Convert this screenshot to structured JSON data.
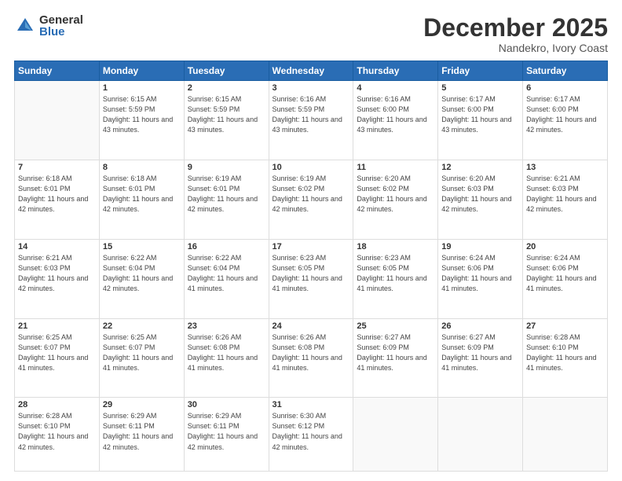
{
  "logo": {
    "general": "General",
    "blue": "Blue"
  },
  "title": "December 2025",
  "subtitle": "Nandekro, Ivory Coast",
  "days_header": [
    "Sunday",
    "Monday",
    "Tuesday",
    "Wednesday",
    "Thursday",
    "Friday",
    "Saturday"
  ],
  "weeks": [
    [
      {
        "num": "",
        "empty": true
      },
      {
        "num": "1",
        "sunrise": "Sunrise: 6:15 AM",
        "sunset": "Sunset: 5:59 PM",
        "daylight": "Daylight: 11 hours and 43 minutes."
      },
      {
        "num": "2",
        "sunrise": "Sunrise: 6:15 AM",
        "sunset": "Sunset: 5:59 PM",
        "daylight": "Daylight: 11 hours and 43 minutes."
      },
      {
        "num": "3",
        "sunrise": "Sunrise: 6:16 AM",
        "sunset": "Sunset: 5:59 PM",
        "daylight": "Daylight: 11 hours and 43 minutes."
      },
      {
        "num": "4",
        "sunrise": "Sunrise: 6:16 AM",
        "sunset": "Sunset: 6:00 PM",
        "daylight": "Daylight: 11 hours and 43 minutes."
      },
      {
        "num": "5",
        "sunrise": "Sunrise: 6:17 AM",
        "sunset": "Sunset: 6:00 PM",
        "daylight": "Daylight: 11 hours and 43 minutes."
      },
      {
        "num": "6",
        "sunrise": "Sunrise: 6:17 AM",
        "sunset": "Sunset: 6:00 PM",
        "daylight": "Daylight: 11 hours and 42 minutes."
      }
    ],
    [
      {
        "num": "7",
        "sunrise": "Sunrise: 6:18 AM",
        "sunset": "Sunset: 6:01 PM",
        "daylight": "Daylight: 11 hours and 42 minutes."
      },
      {
        "num": "8",
        "sunrise": "Sunrise: 6:18 AM",
        "sunset": "Sunset: 6:01 PM",
        "daylight": "Daylight: 11 hours and 42 minutes."
      },
      {
        "num": "9",
        "sunrise": "Sunrise: 6:19 AM",
        "sunset": "Sunset: 6:01 PM",
        "daylight": "Daylight: 11 hours and 42 minutes."
      },
      {
        "num": "10",
        "sunrise": "Sunrise: 6:19 AM",
        "sunset": "Sunset: 6:02 PM",
        "daylight": "Daylight: 11 hours and 42 minutes."
      },
      {
        "num": "11",
        "sunrise": "Sunrise: 6:20 AM",
        "sunset": "Sunset: 6:02 PM",
        "daylight": "Daylight: 11 hours and 42 minutes."
      },
      {
        "num": "12",
        "sunrise": "Sunrise: 6:20 AM",
        "sunset": "Sunset: 6:03 PM",
        "daylight": "Daylight: 11 hours and 42 minutes."
      },
      {
        "num": "13",
        "sunrise": "Sunrise: 6:21 AM",
        "sunset": "Sunset: 6:03 PM",
        "daylight": "Daylight: 11 hours and 42 minutes."
      }
    ],
    [
      {
        "num": "14",
        "sunrise": "Sunrise: 6:21 AM",
        "sunset": "Sunset: 6:03 PM",
        "daylight": "Daylight: 11 hours and 42 minutes."
      },
      {
        "num": "15",
        "sunrise": "Sunrise: 6:22 AM",
        "sunset": "Sunset: 6:04 PM",
        "daylight": "Daylight: 11 hours and 42 minutes."
      },
      {
        "num": "16",
        "sunrise": "Sunrise: 6:22 AM",
        "sunset": "Sunset: 6:04 PM",
        "daylight": "Daylight: 11 hours and 41 minutes."
      },
      {
        "num": "17",
        "sunrise": "Sunrise: 6:23 AM",
        "sunset": "Sunset: 6:05 PM",
        "daylight": "Daylight: 11 hours and 41 minutes."
      },
      {
        "num": "18",
        "sunrise": "Sunrise: 6:23 AM",
        "sunset": "Sunset: 6:05 PM",
        "daylight": "Daylight: 11 hours and 41 minutes."
      },
      {
        "num": "19",
        "sunrise": "Sunrise: 6:24 AM",
        "sunset": "Sunset: 6:06 PM",
        "daylight": "Daylight: 11 hours and 41 minutes."
      },
      {
        "num": "20",
        "sunrise": "Sunrise: 6:24 AM",
        "sunset": "Sunset: 6:06 PM",
        "daylight": "Daylight: 11 hours and 41 minutes."
      }
    ],
    [
      {
        "num": "21",
        "sunrise": "Sunrise: 6:25 AM",
        "sunset": "Sunset: 6:07 PM",
        "daylight": "Daylight: 11 hours and 41 minutes."
      },
      {
        "num": "22",
        "sunrise": "Sunrise: 6:25 AM",
        "sunset": "Sunset: 6:07 PM",
        "daylight": "Daylight: 11 hours and 41 minutes."
      },
      {
        "num": "23",
        "sunrise": "Sunrise: 6:26 AM",
        "sunset": "Sunset: 6:08 PM",
        "daylight": "Daylight: 11 hours and 41 minutes."
      },
      {
        "num": "24",
        "sunrise": "Sunrise: 6:26 AM",
        "sunset": "Sunset: 6:08 PM",
        "daylight": "Daylight: 11 hours and 41 minutes."
      },
      {
        "num": "25",
        "sunrise": "Sunrise: 6:27 AM",
        "sunset": "Sunset: 6:09 PM",
        "daylight": "Daylight: 11 hours and 41 minutes."
      },
      {
        "num": "26",
        "sunrise": "Sunrise: 6:27 AM",
        "sunset": "Sunset: 6:09 PM",
        "daylight": "Daylight: 11 hours and 41 minutes."
      },
      {
        "num": "27",
        "sunrise": "Sunrise: 6:28 AM",
        "sunset": "Sunset: 6:10 PM",
        "daylight": "Daylight: 11 hours and 41 minutes."
      }
    ],
    [
      {
        "num": "28",
        "sunrise": "Sunrise: 6:28 AM",
        "sunset": "Sunset: 6:10 PM",
        "daylight": "Daylight: 11 hours and 42 minutes."
      },
      {
        "num": "29",
        "sunrise": "Sunrise: 6:29 AM",
        "sunset": "Sunset: 6:11 PM",
        "daylight": "Daylight: 11 hours and 42 minutes."
      },
      {
        "num": "30",
        "sunrise": "Sunrise: 6:29 AM",
        "sunset": "Sunset: 6:11 PM",
        "daylight": "Daylight: 11 hours and 42 minutes."
      },
      {
        "num": "31",
        "sunrise": "Sunrise: 6:30 AM",
        "sunset": "Sunset: 6:12 PM",
        "daylight": "Daylight: 11 hours and 42 minutes."
      },
      {
        "num": "",
        "empty": true
      },
      {
        "num": "",
        "empty": true
      },
      {
        "num": "",
        "empty": true
      }
    ]
  ]
}
